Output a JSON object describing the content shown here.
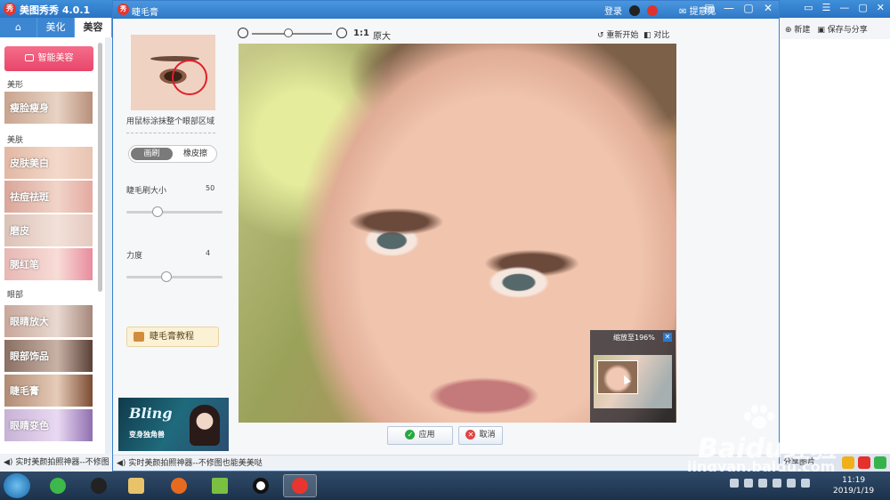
{
  "main": {
    "title": "美图秀秀 4.0.1",
    "tabs": [
      "美化",
      "美容"
    ],
    "smart_button": "智能美容",
    "categories": {
      "shape": "美形",
      "skin": "美肤",
      "eye": "眼部"
    },
    "features": [
      "瘦脸瘦身",
      "皮肤美白",
      "祛痘祛斑",
      "磨皮",
      "腮红笔",
      "眼睛放大",
      "眼部饰品",
      "睫毛膏",
      "眼睛变色"
    ],
    "right_top": {
      "new": "新建",
      "save": "保存与分享"
    },
    "share_label": "分享图片",
    "status": "实时美颜拍照神器--不修图"
  },
  "dialog": {
    "title": "睫毛膏",
    "login": "登录",
    "feedback": "提意见",
    "hint": "用鼠标涂抹整个眼部区域",
    "mode_brush": "画刷",
    "mode_eraser": "橡皮擦",
    "brush_size_label": "睫毛刷大小",
    "brush_size_value": "50",
    "brush_size_fraction": 0.27,
    "strength_label": "力度",
    "strength_value": "4",
    "strength_fraction": 0.36,
    "tutorial_button": "睫毛膏教程",
    "ad": {
      "title": "Bling",
      "subtitle": "变身独角兽"
    },
    "toolbar": {
      "one_to_one": "1:1",
      "original": "原大",
      "restart": "重新开始",
      "compare": "对比",
      "zoom_fraction": 0.45
    },
    "minimap_title": "缩放至196%",
    "apply": "应用",
    "cancel": "取消",
    "status": "实时美颜拍照神器--不修图也能美美哒"
  },
  "taskbar": {
    "time": "11:19",
    "date": "2019/1/19"
  },
  "watermark": {
    "brand": "Baidu经验",
    "url": "jingyan.baidu.com"
  }
}
